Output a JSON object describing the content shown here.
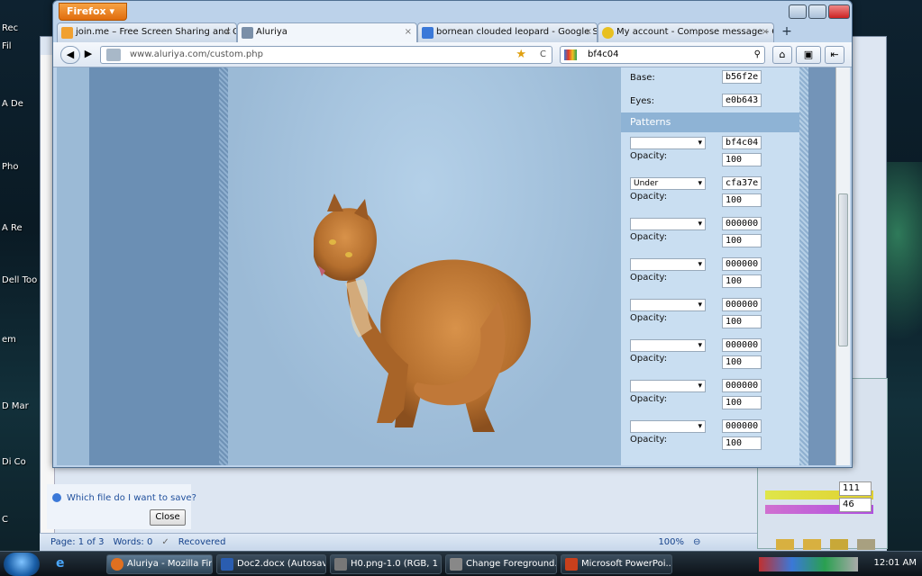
{
  "desktop": {
    "icons": [
      "Rec",
      "Fil",
      "A De",
      "Pho",
      "A Re",
      "Dell Too",
      "em",
      "D Mar",
      "Di Co",
      "C"
    ]
  },
  "word": {
    "help_link": "Which file do I want to save?",
    "close_label": "Close",
    "status_page": "Page: 1 of 3",
    "status_words": "Words: 0",
    "status_recovered": "Recovered",
    "zoom": "100%"
  },
  "side_panel": {
    "val1": "111",
    "val2": "46"
  },
  "firefox": {
    "menu_label": "Firefox",
    "tabs": [
      {
        "label": "join.me – Free Screen Sharing and On...",
        "color": "#f0a030"
      },
      {
        "label": "Aluriya",
        "color": "#7a8fa8"
      },
      {
        "label": "bornean clouded leopard - Google Se...",
        "color": "#3a78d8"
      },
      {
        "label": "My account - Compose message - C...",
        "color": "#e8c020"
      }
    ],
    "new_tab": "+",
    "url": "www.aluriya.com/custom.php",
    "search_text": "bf4c04"
  },
  "form": {
    "base_label": "Base:",
    "base_value": "b56f2e",
    "eyes_label": "Eyes:",
    "eyes_value": "e0b643",
    "patterns_heading": "Patterns",
    "opacity_label": "Opacity:",
    "rows": [
      {
        "select": "",
        "color": "bf4c04",
        "opacity": "100"
      },
      {
        "select": "Under",
        "color": "cfa37e",
        "opacity": "100"
      },
      {
        "select": "",
        "color": "000000",
        "opacity": "100"
      },
      {
        "select": "",
        "color": "000000",
        "opacity": "100"
      },
      {
        "select": "",
        "color": "000000",
        "opacity": "100"
      },
      {
        "select": "",
        "color": "000000",
        "opacity": "100"
      },
      {
        "select": "",
        "color": "000000",
        "opacity": "100"
      },
      {
        "select": "",
        "color": "000000",
        "opacity": "100"
      }
    ]
  },
  "taskbar": {
    "items": [
      {
        "label": "Aluriya - Mozilla Fir...",
        "color": "#e07020"
      },
      {
        "label": "Doc2.docx (Autosav...",
        "color": "#2a5db0"
      },
      {
        "label": "H0.png-1.0 (RGB, 1 l...",
        "color": "#777"
      },
      {
        "label": "Change Foreground...",
        "color": "#888"
      },
      {
        "label": "Microsoft PowerPoi...",
        "color": "#c8401c"
      }
    ],
    "clock": "12:01 AM"
  }
}
